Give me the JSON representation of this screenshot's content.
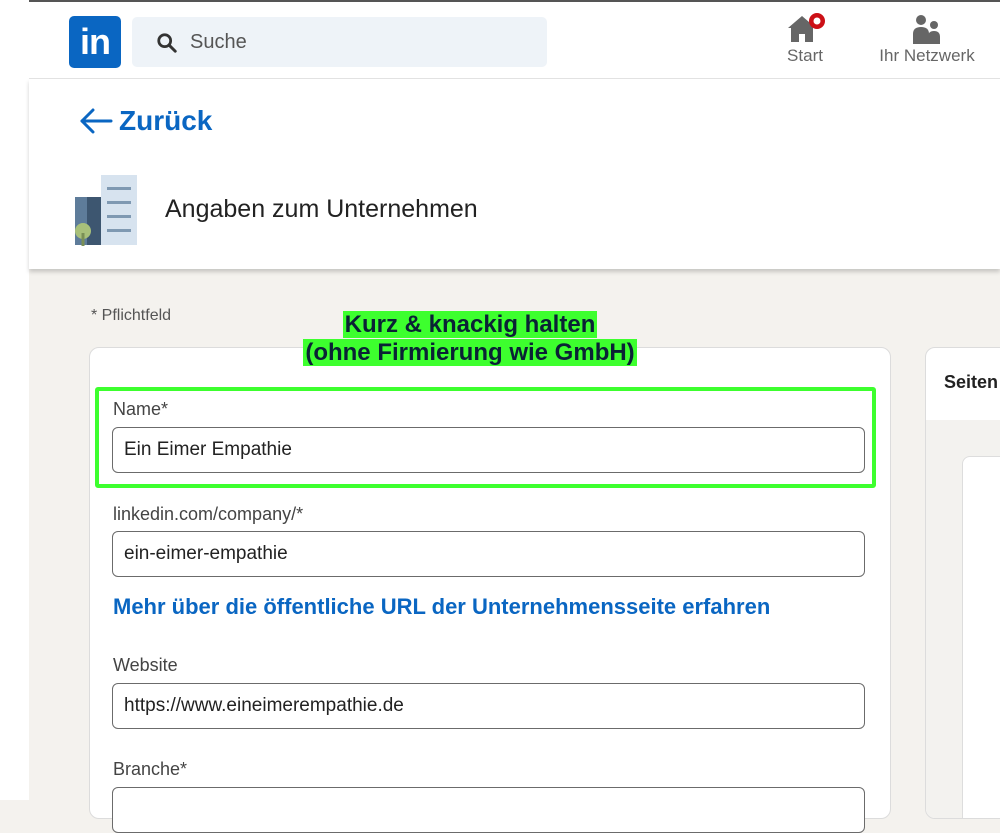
{
  "topbar": {
    "logo_text": "in",
    "search_placeholder": "Suche",
    "nav": {
      "start_label": "Start",
      "network_label": "Ihr Netzwerk"
    }
  },
  "header": {
    "back_label": "Zurück",
    "title": "Angaben zum Unternehmen"
  },
  "required_note": "* Pflichtfeld",
  "callout": {
    "line1": "Kurz & knackig halten",
    "line2": "(ohne Firmierung wie GmbH)"
  },
  "form": {
    "name_label": "Name*",
    "name_value": "Ein Eimer Empathie",
    "url_label": "linkedin.com/company/*",
    "url_value": "ein-eimer-empathie",
    "url_info_link": "Mehr über die öffentliche URL der Unternehmensseite erfahren",
    "website_label": "Website",
    "website_value": "https://www.eineimerempathie.de",
    "industry_label": "Branche*",
    "industry_value": ""
  },
  "side_panel": {
    "title": "Seiten"
  },
  "colors": {
    "brand": "#0a66c2",
    "highlight": "#3dff2e",
    "notification": "#cc1016"
  }
}
